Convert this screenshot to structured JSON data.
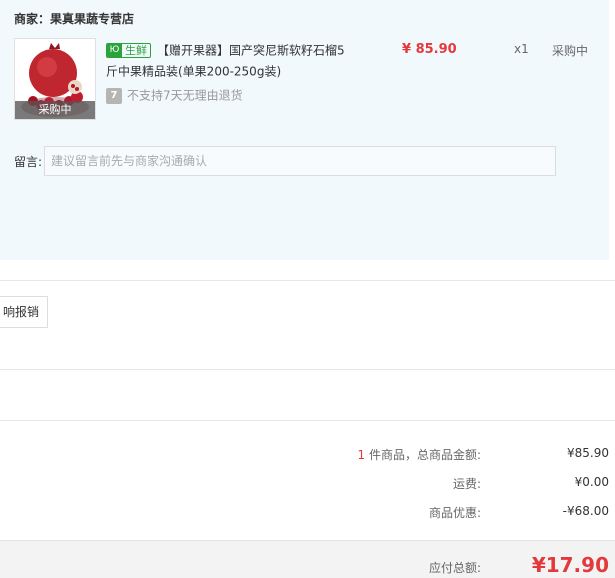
{
  "merchant": {
    "label": "商家：果真果蔬专营店"
  },
  "product": {
    "thumb_tag": "采购中",
    "badge_icon": "Ю",
    "badge_text": "生鲜",
    "title": "【赠开果器】国产突尼斯软籽石榴5斤中果精品装(单果200-250g装)",
    "return_icon": "7",
    "return_policy": "不支持7天无理由退货",
    "price": "¥ 85.90",
    "qty": "x1",
    "status": "采购中"
  },
  "remark": {
    "label": "留言:",
    "placeholder": "建议留言前先与商家沟通确认"
  },
  "invoice": {
    "button_label": "响报销"
  },
  "summary": {
    "count": "1",
    "items_label": " 件商品，总商品金额:",
    "items_value": "¥85.90",
    "shipping_label": "运费:",
    "shipping_value": "¥0.00",
    "discount_label": "商品优惠:",
    "discount_value": "-¥68.00",
    "total_label": "应付总额:",
    "total_value": "¥17.90"
  },
  "colors": {
    "accent_red": "#e4393c",
    "fresh_green": "#2aa33a",
    "panel_bg": "#f2f9fd"
  }
}
